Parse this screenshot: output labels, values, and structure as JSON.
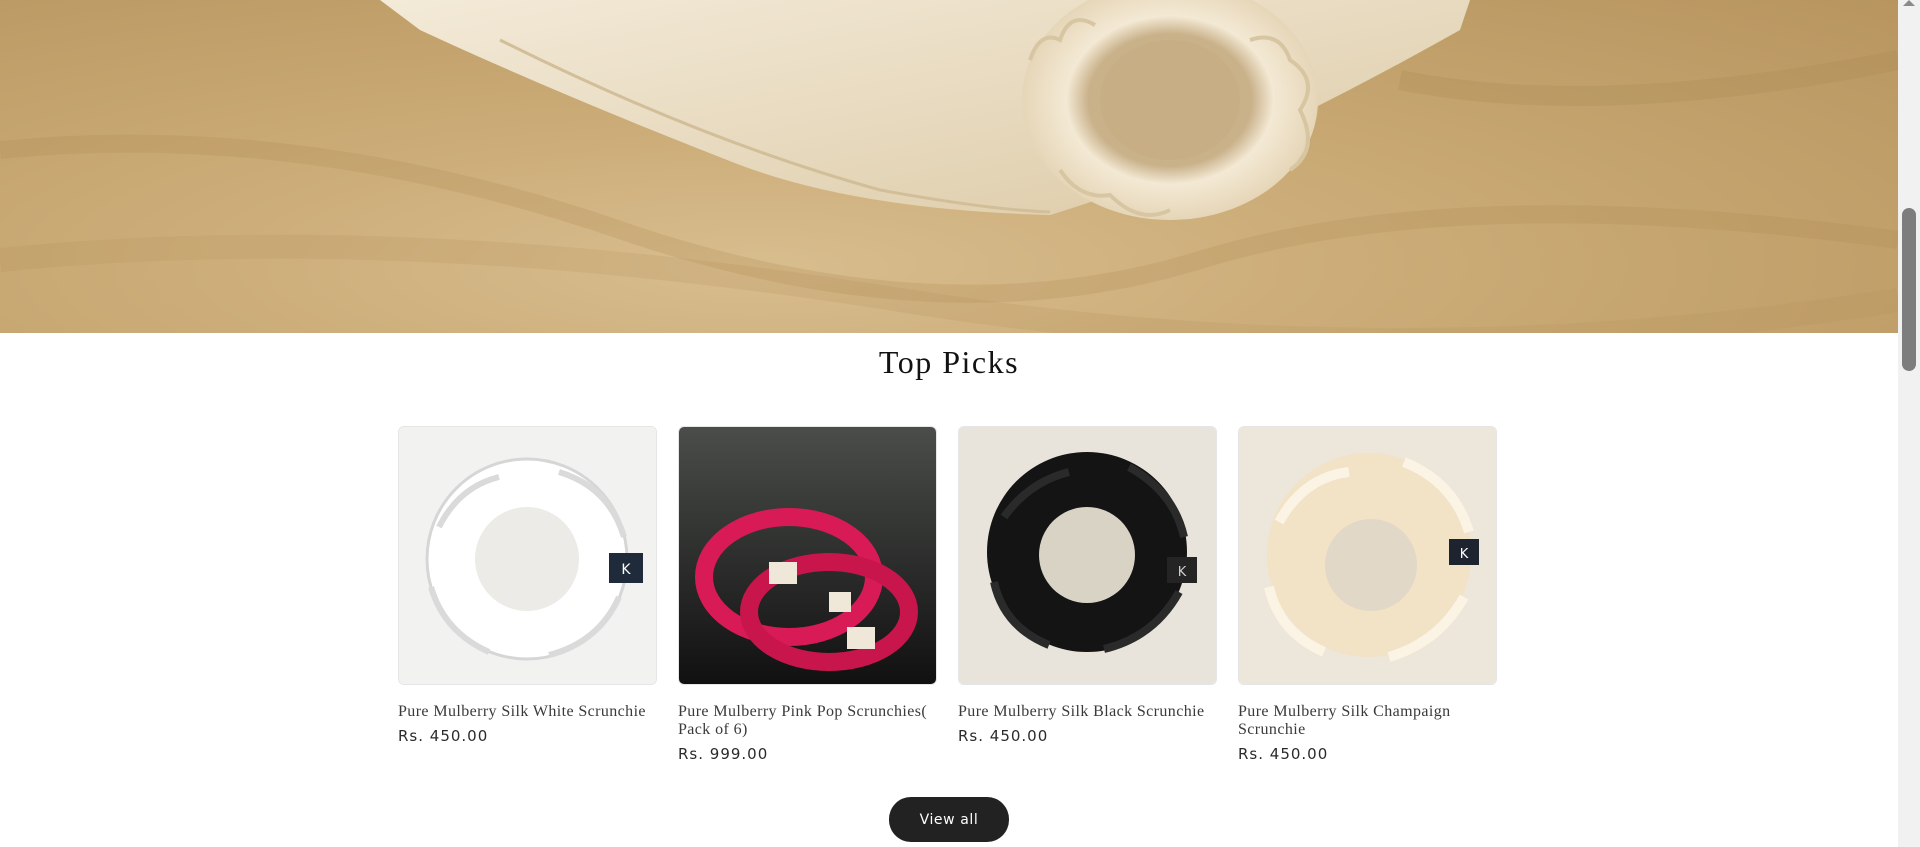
{
  "section": {
    "title": "Top Picks"
  },
  "products": [
    {
      "title": "Pure Mulberry Silk White Scrunchie",
      "price": "Rs. 450.00",
      "image": "white silk scrunchie"
    },
    {
      "title": "Pure Mulberry Pink Pop Scrunchies( Pack of 6)",
      "price": "Rs. 999.00",
      "image": "pink scrunchies pack"
    },
    {
      "title": "Pure Mulberry Silk Black Scrunchie",
      "price": "Rs. 450.00",
      "image": "black silk scrunchie"
    },
    {
      "title": "Pure Mulberry Silk Champaign Scrunchie",
      "price": "Rs. 450.00",
      "image": "champagne silk scrunchie"
    }
  ],
  "buttons": {
    "view_all": "View all"
  },
  "labels": {
    "tag_letter": "K"
  },
  "colors": {
    "button_bg": "#222222",
    "hero_tone": "#c9a974"
  }
}
